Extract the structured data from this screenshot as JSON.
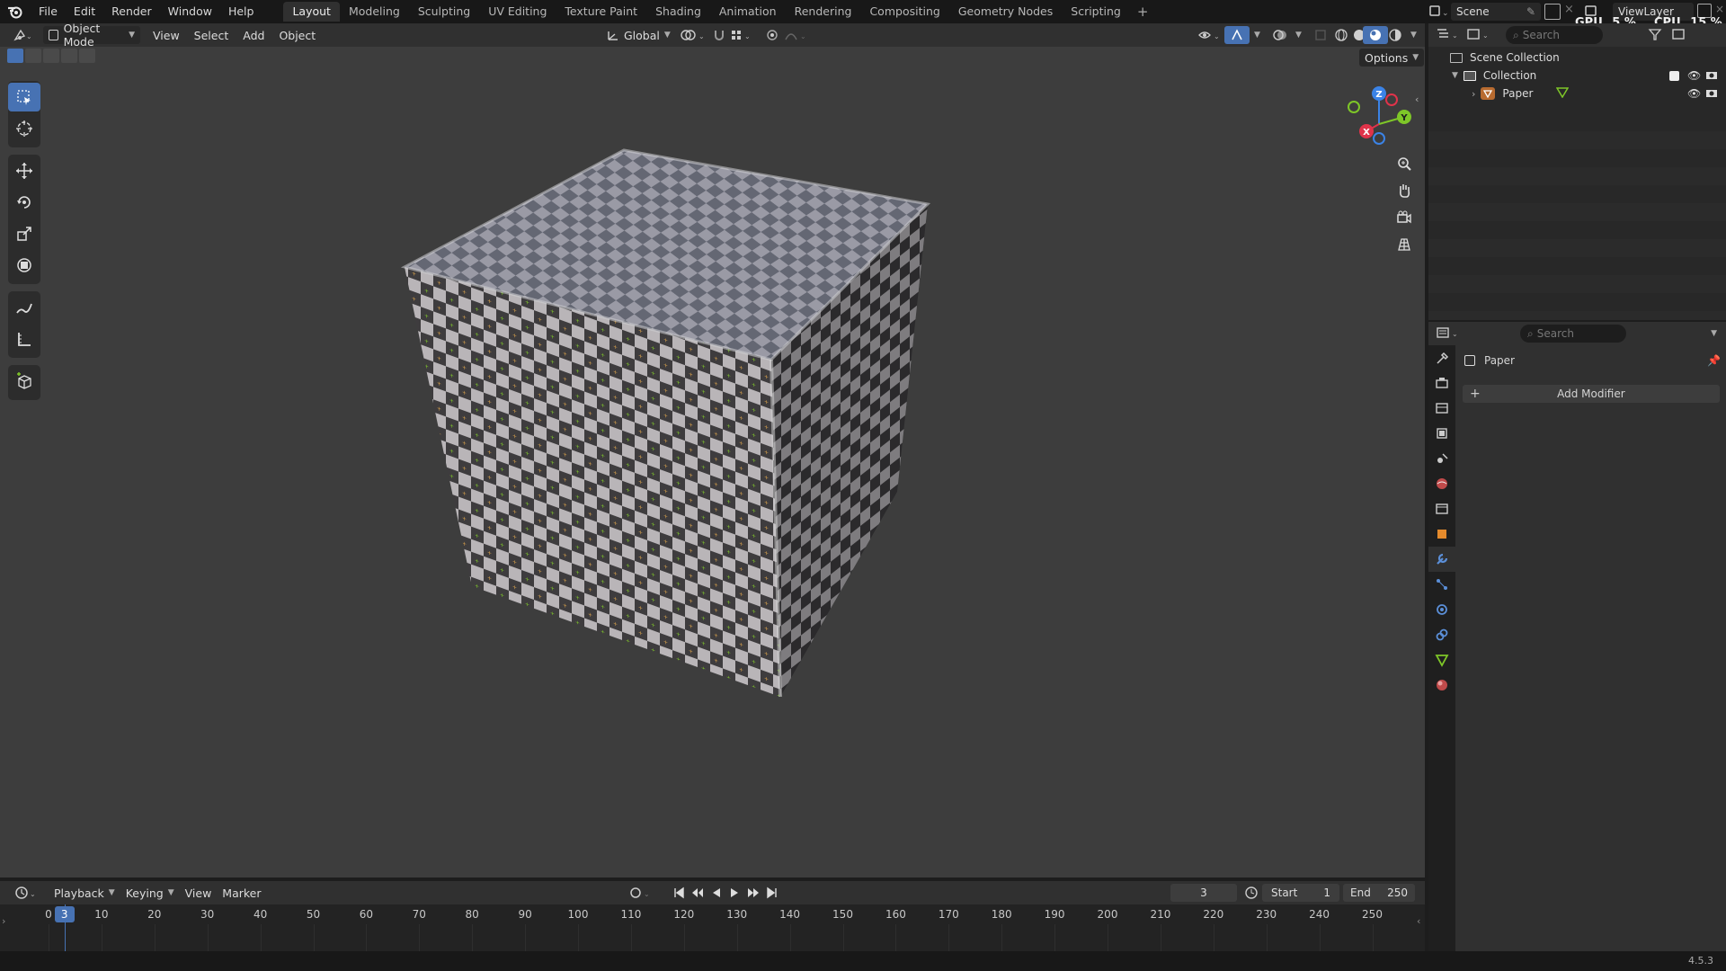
{
  "menu": {
    "file": "File",
    "edit": "Edit",
    "render": "Render",
    "window": "Window",
    "help": "Help"
  },
  "workspaces": [
    "Layout",
    "Modeling",
    "Sculpting",
    "UV Editing",
    "Texture Paint",
    "Shading",
    "Animation",
    "Rendering",
    "Compositing",
    "Geometry Nodes",
    "Scripting"
  ],
  "active_workspace": "Layout",
  "scene": {
    "name": "Scene",
    "view_layer": "ViewLayer"
  },
  "stats": {
    "gpu_label": "GPU",
    "gpu_value": "5 %",
    "cpu_label": "CPU",
    "cpu_value": "15 %"
  },
  "viewport_header": {
    "mode": "Object Mode",
    "view": "View",
    "select": "Select",
    "add": "Add",
    "object": "Object",
    "orientation": "Global",
    "options": "Options"
  },
  "gizmo": {
    "x": "X",
    "y": "Y",
    "z": "Z"
  },
  "outliner": {
    "search_placeholder": "Search",
    "scene_collection": "Scene Collection",
    "collection": "Collection",
    "object": "Paper"
  },
  "properties": {
    "search_placeholder": "Search",
    "object_name": "Paper",
    "add_modifier": "Add Modifier"
  },
  "timeline": {
    "playback": "Playback",
    "keying": "Keying",
    "view": "View",
    "marker": "Marker",
    "current_frame": "3",
    "start_label": "Start",
    "start_value": "1",
    "end_label": "End",
    "end_value": "250",
    "ticks": [
      "0",
      "10",
      "20",
      "30",
      "40",
      "50",
      "60",
      "70",
      "80",
      "90",
      "100",
      "110",
      "120",
      "130",
      "140",
      "150",
      "160",
      "170",
      "180",
      "190",
      "200",
      "210",
      "220",
      "230",
      "240",
      "250"
    ],
    "playhead": "3"
  },
  "version": "4.5.3",
  "colors": {
    "accent": "#4772b3",
    "x_axis": "#e0334a",
    "y_axis": "#7ec628",
    "z_axis": "#3b83e6",
    "modifier_icon": "#5b8fd8"
  }
}
